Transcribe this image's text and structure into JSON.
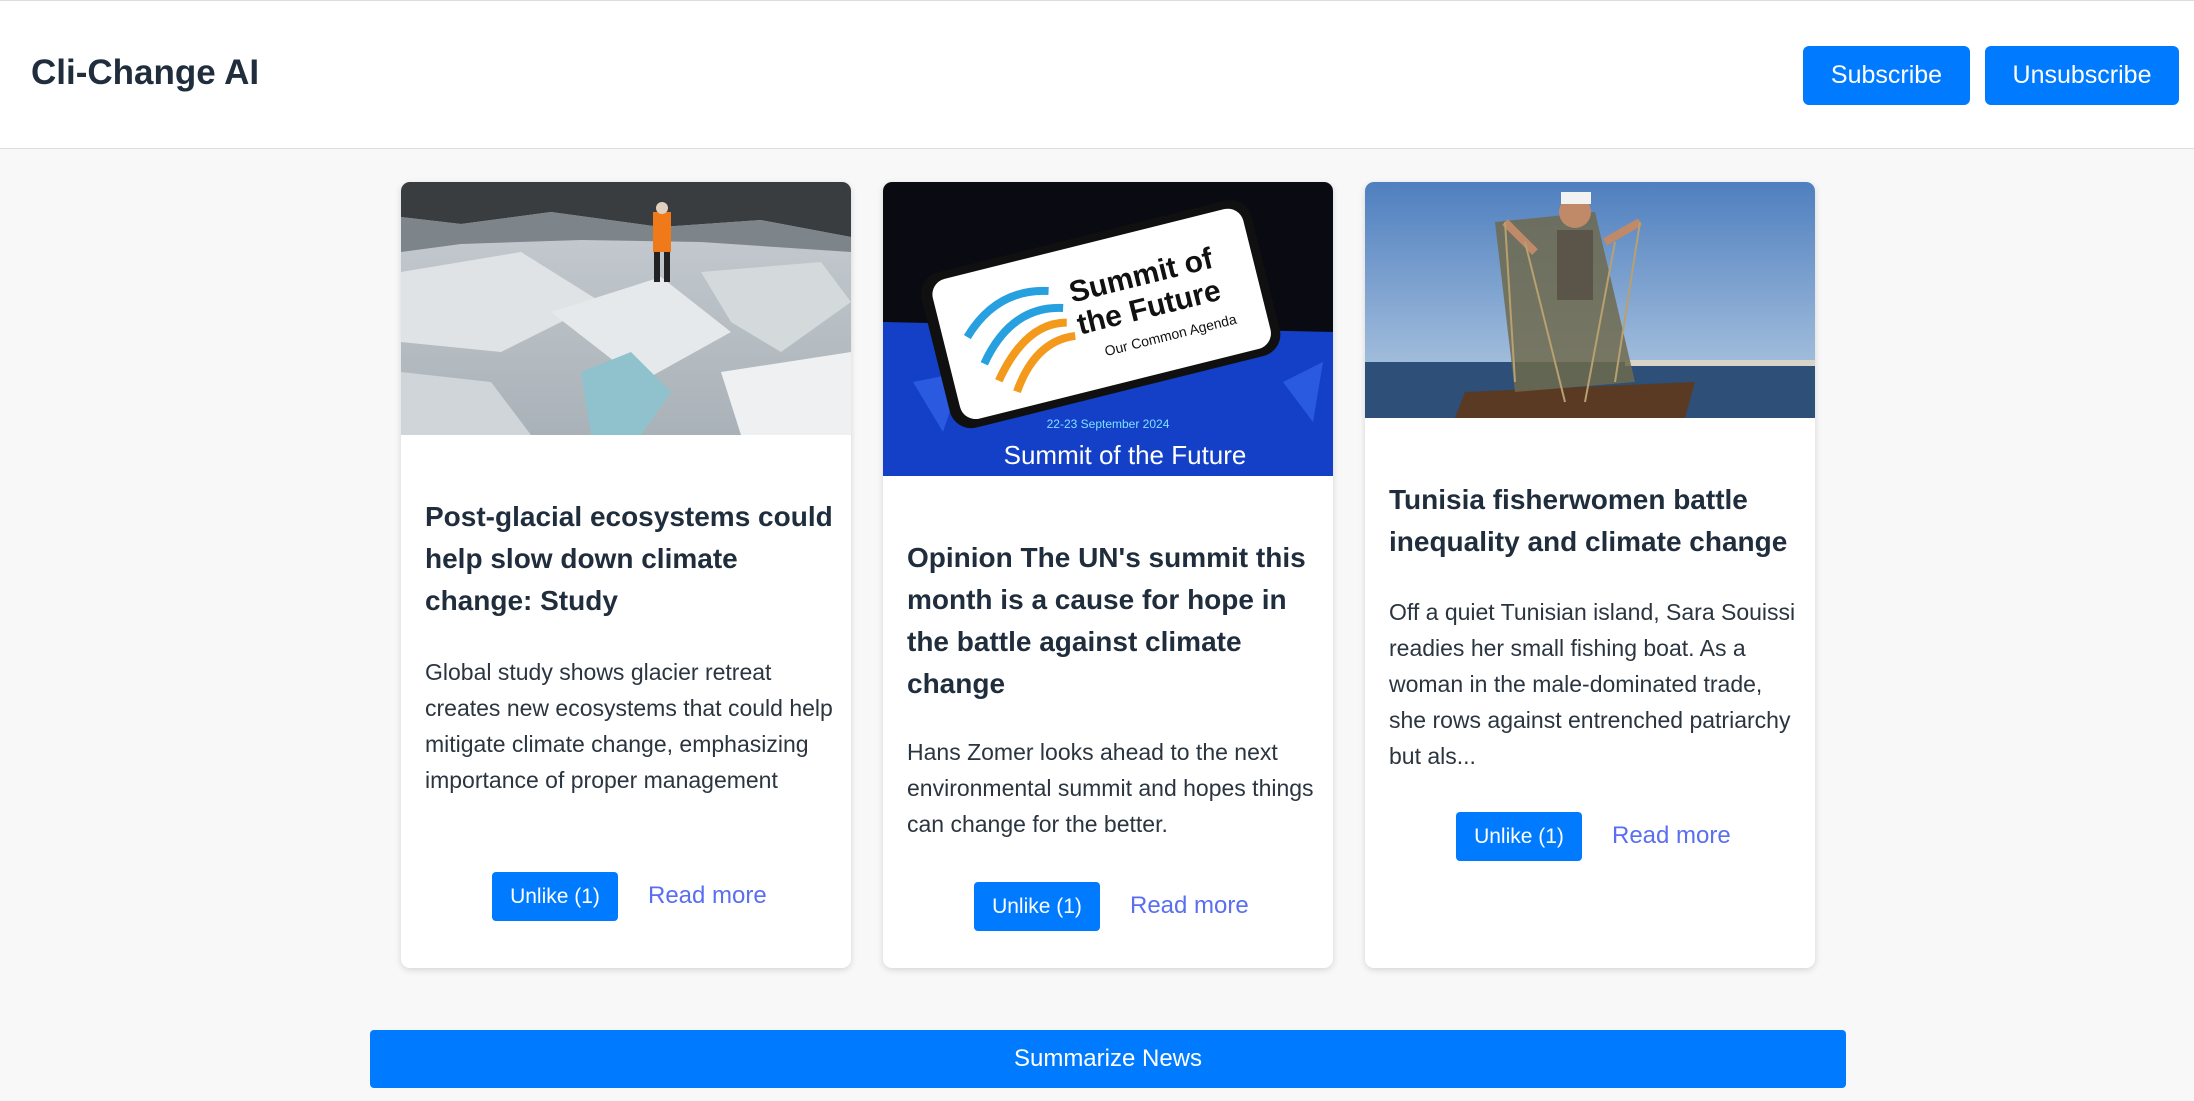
{
  "header": {
    "title": "Cli-Change AI",
    "subscribe_label": "Subscribe",
    "unsubscribe_label": "Unsubscribe"
  },
  "articles": [
    {
      "image": "glacier-hiker-photo",
      "title": "Post-glacial ecosystems could help slow down climate change: Study",
      "summary": "Global study shows glacier retreat creates new ecosystems that could help mitigate climate change, emphasizing importance of proper management",
      "like_label": "Unlike (1)",
      "read_more_label": "Read more"
    },
    {
      "image": "summit-of-the-future-phone-photo",
      "image_text": {
        "phone_title_1": "Summit of",
        "phone_title_2": "the Future",
        "phone_subtitle": "Our Common Agenda",
        "date": "22-23 September 2024",
        "banner": "Summit of the Future"
      },
      "title": "Opinion The UN's summit this month is a cause for hope in the battle against climate change",
      "summary": "Hans Zomer looks ahead to the next environmental summit and hopes things can change for the better.",
      "like_label": "Unlike (1)",
      "read_more_label": "Read more"
    },
    {
      "image": "fisherwoman-net-photo",
      "title": "Tunisia fisherwomen battle inequality and climate change",
      "summary": "Off a quiet Tunisian island, Sara Souissi readies her small fishing boat. As a woman in the male-dominated trade, she rows against entrenched patriarchy but als...",
      "like_label": "Unlike (1)",
      "read_more_label": "Read more"
    }
  ],
  "summarize_label": "Summarize News",
  "colors": {
    "accent": "#007bff",
    "link": "#5a6ef0",
    "text": "#1f2d3d",
    "background": "#f8f8f8"
  }
}
